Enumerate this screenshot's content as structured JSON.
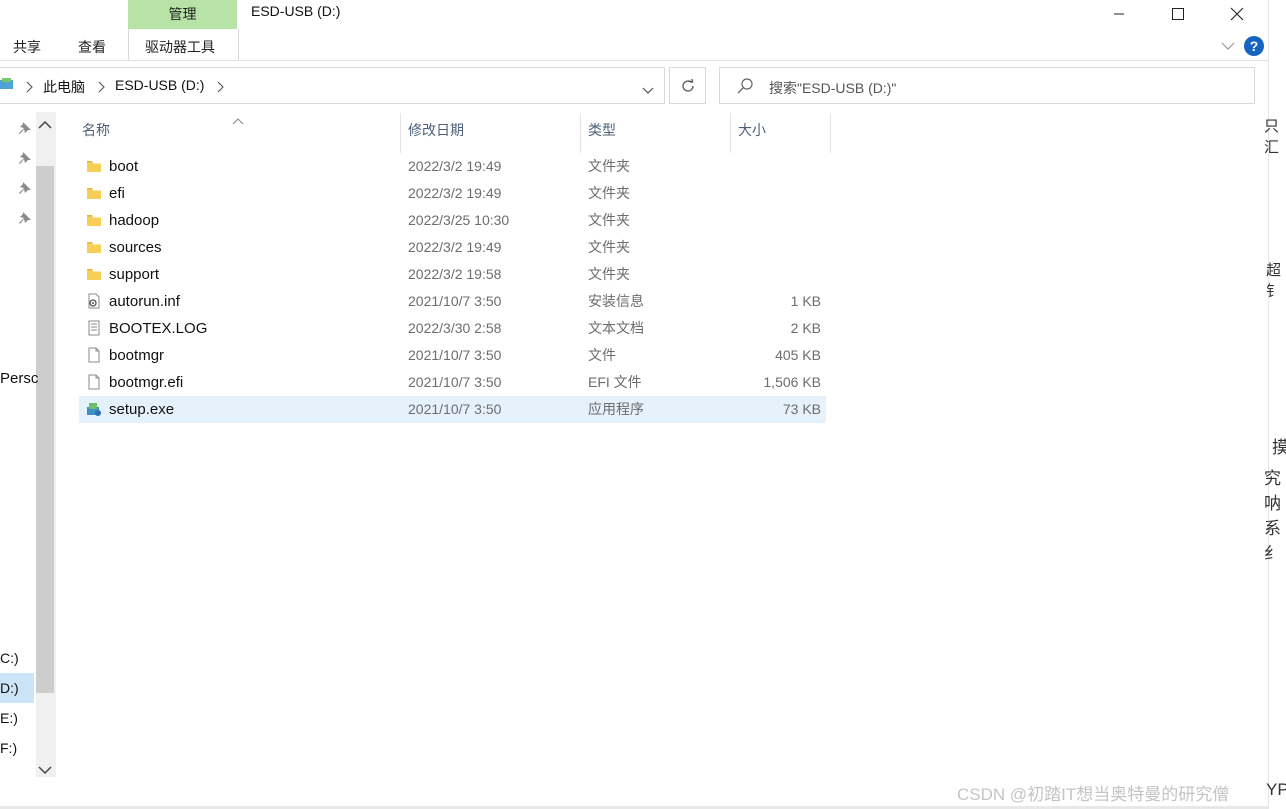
{
  "ribbon": {
    "context_group": "管理",
    "tabs": [
      "共享",
      "查看",
      "驱动器工具"
    ],
    "help_symbol": "?"
  },
  "window": {
    "title": "ESD-USB (D:)"
  },
  "address": {
    "crumbs": [
      "此电脑",
      "ESD-USB (D:)"
    ]
  },
  "search": {
    "placeholder": "搜索\"ESD-USB (D:)\""
  },
  "nav": {
    "partial_items": [
      "Persc",
      "C:)",
      "D:)",
      "E:)",
      "F:)"
    ]
  },
  "columns": {
    "name": "名称",
    "date": "修改日期",
    "type": "类型",
    "size": "大小"
  },
  "files": [
    {
      "name": "boot",
      "date": "2022/3/2 19:49",
      "type": "文件夹",
      "size": "",
      "icon": "folder-icon"
    },
    {
      "name": "efi",
      "date": "2022/3/2 19:49",
      "type": "文件夹",
      "size": "",
      "icon": "folder-icon"
    },
    {
      "name": "hadoop",
      "date": "2022/3/25 10:30",
      "type": "文件夹",
      "size": "",
      "icon": "folder-icon"
    },
    {
      "name": "sources",
      "date": "2022/3/2 19:49",
      "type": "文件夹",
      "size": "",
      "icon": "folder-icon"
    },
    {
      "name": "support",
      "date": "2022/3/2 19:58",
      "type": "文件夹",
      "size": "",
      "icon": "folder-icon"
    },
    {
      "name": "autorun.inf",
      "date": "2021/10/7 3:50",
      "type": "安装信息",
      "size": "1 KB",
      "icon": "settings-file-icon"
    },
    {
      "name": "BOOTEX.LOG",
      "date": "2022/3/30 2:58",
      "type": "文本文档",
      "size": "2 KB",
      "icon": "text-file-icon"
    },
    {
      "name": "bootmgr",
      "date": "2021/10/7 3:50",
      "type": "文件",
      "size": "405 KB",
      "icon": "file-icon"
    },
    {
      "name": "bootmgr.efi",
      "date": "2021/10/7 3:50",
      "type": "EFI 文件",
      "size": "1,506 KB",
      "icon": "file-icon"
    },
    {
      "name": "setup.exe",
      "date": "2021/10/7 3:50",
      "type": "应用程序",
      "size": "73 KB",
      "icon": "setup-exe-icon",
      "selected": true
    }
  ],
  "right_window_fragments": [
    "只汇",
    "超钅",
    "摸",
    "究呐",
    "系纟",
    "YP"
  ],
  "watermark": "CSDN @初踏IT想当奥特曼的研究僧",
  "colors": {
    "manage_tab": "#b7e4a6",
    "selection": "#e5f1fb",
    "help_blue": "#1565c0",
    "folder": "#f7cf57"
  }
}
